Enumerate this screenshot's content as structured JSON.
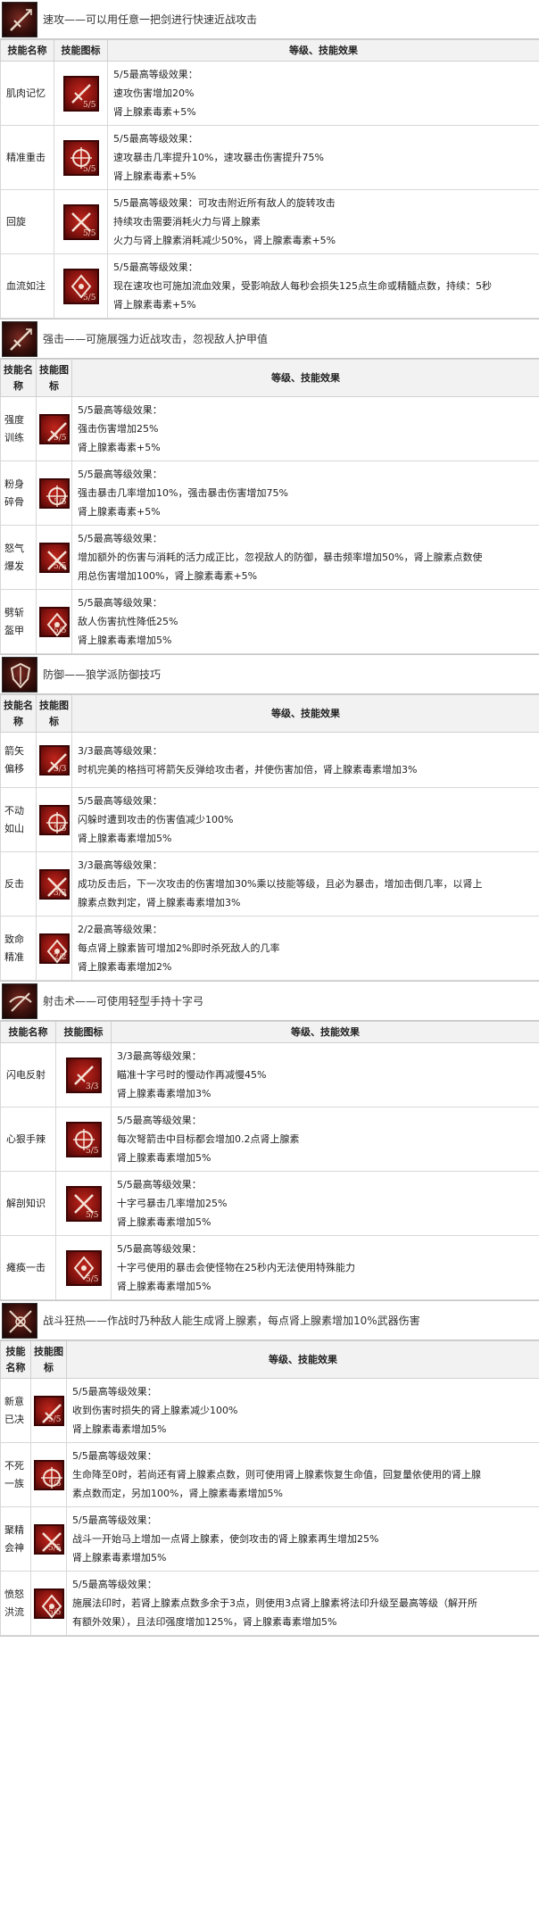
{
  "sections": [
    {
      "title": "速攻——可以用任意一把剑进行快速近战攻击",
      "icon": "quick-attack-icon",
      "headers": [
        "技能名称",
        "技能图标",
        "等级、技能效果"
      ],
      "skills": [
        {
          "name": "肌肉记忆",
          "lvl": "5/5",
          "lines": [
            "5/5最高等级效果：",
            "速攻伤害增加20%",
            "肾上腺素毒素+5%"
          ]
        },
        {
          "name": "精准重击",
          "lvl": "5/5",
          "lines": [
            "5/5最高等级效果：",
            "速攻暴击几率提升10%，速攻暴击伤害提升75%",
            "肾上腺素毒素+5%"
          ]
        },
        {
          "name": "回旋",
          "lvl": "5/5",
          "lines": [
            "5/5最高等级效果：可攻击附近所有敌人的旋转攻击",
            "持续攻击需要消耗火力与肾上腺素",
            "火力与肾上腺素消耗减少50%，肾上腺素毒素+5%"
          ]
        },
        {
          "name": "血流如注",
          "lvl": "5/5",
          "lines": [
            "5/5最高等级效果：",
            "现在速攻也可施加流血效果，受影响敌人每秒会损失125点生命或精髓点数，持续：5秒",
            "肾上腺素毒素+5%"
          ]
        }
      ]
    },
    {
      "title": "强击——可施展强力近战攻击，忽视敌人护甲值",
      "icon": "strong-attack-icon",
      "headers": [
        "技能名称",
        "技能图标",
        "等级、技能效果"
      ],
      "skills": [
        {
          "name": "强度训练",
          "lvl": "5/5",
          "lines": [
            "5/5最高等级效果：",
            "强击伤害增加25%",
            "肾上腺素毒素+5%"
          ]
        },
        {
          "name": "粉身碎骨",
          "lvl": "5/5",
          "lines": [
            "5/5最高等级效果：",
            "强击暴击几率增加10%，强击暴击伤害增加75%",
            "肾上腺素毒素+5%"
          ]
        },
        {
          "name": "怒气爆发",
          "lvl": "5/5",
          "lines": [
            "5/5最高等级效果：",
            "增加额外的伤害与消耗的活力成正比，忽视敌人的防御，暴击频率增加50%，肾上腺素点数使",
            "用总伤害增加100%，肾上腺素毒素+5%"
          ]
        },
        {
          "name": "劈斩盔甲",
          "lvl": "5/5",
          "lines": [
            "5/5最高等级效果：",
            "敌人伤害抗性降低25%",
            "肾上腺素毒素增加5%"
          ]
        }
      ]
    },
    {
      "title": "防御——狼学派防御技巧",
      "icon": "defense-icon",
      "headers": [
        "技能名称",
        "技能图标",
        "等级、技能效果"
      ],
      "skills": [
        {
          "name": "箭矢偏移",
          "lvl": "3/3",
          "lines": [
            "3/3最高等级效果：",
            "时机完美的格挡可将箭矢反弹给攻击者，并使伤害加倍，肾上腺素毒素增加3%"
          ]
        },
        {
          "name": "不动如山",
          "lvl": "5/5",
          "lines": [
            "5/5最高等级效果：",
            "闪躲时遭到攻击的伤害值减少100%",
            "肾上腺素毒素增加5%"
          ]
        },
        {
          "name": "反击",
          "lvl": "3/3",
          "lines": [
            "3/3最高等级效果：",
            "成功反击后，下一次攻击的伤害增加30%乘以技能等级，且必为暴击，增加击倒几率，以肾上",
            "腺素点数判定，肾上腺素毒素增加3%"
          ]
        },
        {
          "name": "致命精准",
          "lvl": "2/2",
          "lines": [
            "2/2最高等级效果：",
            "每点肾上腺素皆可增加2%即时杀死敌人的几率",
            "肾上腺素毒素增加2%"
          ]
        }
      ]
    },
    {
      "title": "射击术——可使用轻型手持十字弓",
      "icon": "crossbow-icon",
      "headers": [
        "技能名称",
        "技能图标",
        "等级、技能效果"
      ],
      "skills": [
        {
          "name": "闪电反射",
          "lvl": "3/3",
          "lines": [
            "3/3最高等级效果：",
            "瞄准十字弓时的慢动作再减慢45%",
            "肾上腺素毒素增加3%"
          ]
        },
        {
          "name": "心狠手辣",
          "lvl": "5/5",
          "lines": [
            "5/5最高等级效果：",
            "每次弩箭击中目标都会增加0.2点肾上腺素",
            "肾上腺素毒素增加5%"
          ]
        },
        {
          "name": "解剖知识",
          "lvl": "5/5",
          "lines": [
            "5/5最高等级效果：",
            "十字弓暴击几率增加25%",
            "肾上腺素毒素增加5%"
          ]
        },
        {
          "name": "瘫痪一击",
          "lvl": "5/5",
          "lines": [
            "5/5最高等级效果：",
            "十字弓使用的暴击会使怪物在25秒内无法使用特殊能力",
            "肾上腺素毒素增加5%"
          ]
        }
      ]
    },
    {
      "title": "战斗狂热——作战时乃种敌人能生成肾上腺素，每点肾上腺素增加10%武器伤害",
      "icon": "battle-trance-icon",
      "headers": [
        "技能名称",
        "技能图标",
        "等级、技能效果"
      ],
      "skills": [
        {
          "name": "新意已决",
          "lvl": "5/5",
          "lines": [
            "5/5最高等级效果：",
            "收到伤害时损失的肾上腺素减少100%",
            "肾上腺素毒素增加5%"
          ]
        },
        {
          "name": "不死一族",
          "lvl": "5/5",
          "lines": [
            "5/5最高等级效果：",
            "生命降至0时，若尚还有肾上腺素点数，则可使用肾上腺素恢复生命值，回复量依使用的肾上腺",
            "素点数而定，另加100%，肾上腺素毒素增加5%"
          ]
        },
        {
          "name": "聚精会神",
          "lvl": "5/5",
          "lines": [
            "5/5最高等级效果：",
            "战斗一开始马上增加一点肾上腺素，使剑攻击的肾上腺素再生增加25%",
            "肾上腺素毒素增加5%"
          ]
        },
        {
          "name": "愤怒洪流",
          "lvl": "5/5",
          "lines": [
            "5/5最高等级效果：",
            "施展法印时，若肾上腺素点数多余于3点，则使用3点肾上腺素将法印升级至最高等级（解开所",
            "有额外效果），且法印强度增加125%，肾上腺素毒素增加5%"
          ]
        }
      ]
    }
  ]
}
